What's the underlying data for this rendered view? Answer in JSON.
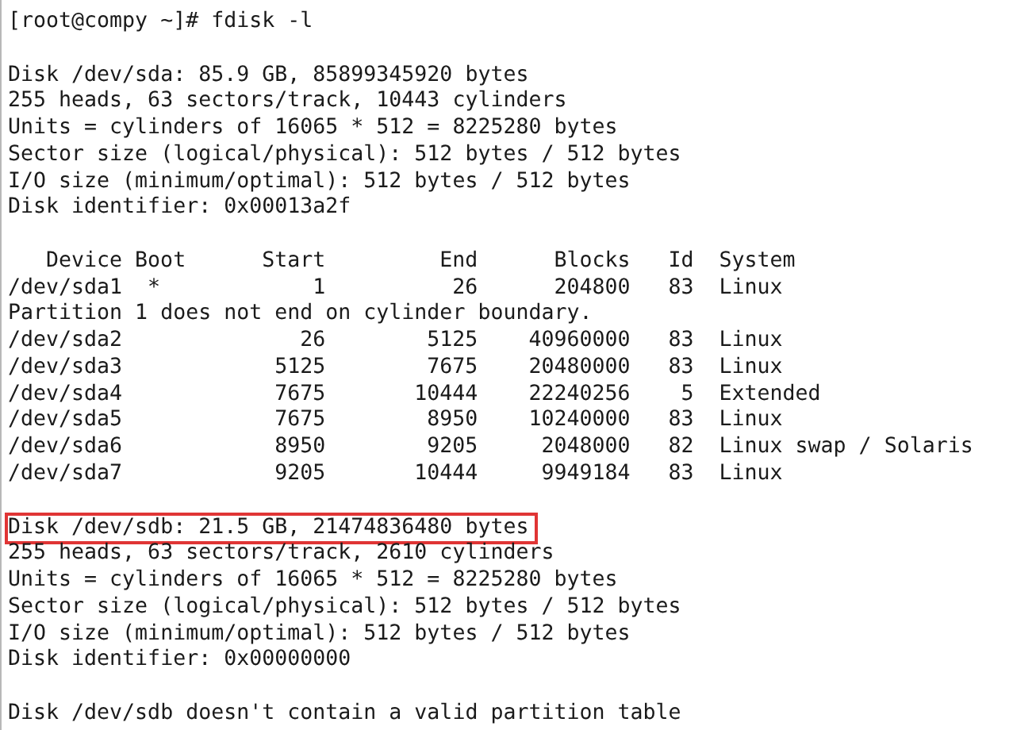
{
  "terminal": {
    "lines": [
      {
        "kind": "text",
        "text": "[root@compy ~]# fdisk -l",
        "highlighted": false
      },
      {
        "kind": "blank"
      },
      {
        "kind": "text",
        "text": "Disk /dev/sda: 85.9 GB, 85899345920 bytes",
        "highlighted": false
      },
      {
        "kind": "text",
        "text": "255 heads, 63 sectors/track, 10443 cylinders",
        "highlighted": false
      },
      {
        "kind": "text",
        "text": "Units = cylinders of 16065 * 512 = 8225280 bytes",
        "highlighted": false
      },
      {
        "kind": "text",
        "text": "Sector size (logical/physical): 512 bytes / 512 bytes",
        "highlighted": false
      },
      {
        "kind": "text",
        "text": "I/O size (minimum/optimal): 512 bytes / 512 bytes",
        "highlighted": false
      },
      {
        "kind": "text",
        "text": "Disk identifier: 0x00013a2f",
        "highlighted": false
      },
      {
        "kind": "blank"
      },
      {
        "kind": "table",
        "columns": [
          "Device",
          "Boot",
          "Start",
          "End",
          "Blocks",
          "Id",
          "System"
        ],
        "rows": [
          {
            "kind": "partition",
            "device": "/dev/sda1",
            "boot": "*",
            "start": "1",
            "end": "26",
            "blocks": "204800",
            "id": "83",
            "system": "Linux"
          },
          {
            "kind": "note",
            "text": "Partition 1 does not end on cylinder boundary."
          },
          {
            "kind": "partition",
            "device": "/dev/sda2",
            "start": "26",
            "end": "5125",
            "blocks": "40960000",
            "id": "83",
            "system": "Linux"
          },
          {
            "kind": "partition",
            "device": "/dev/sda3",
            "start": "5125",
            "end": "7675",
            "blocks": "20480000",
            "id": "83",
            "system": "Linux"
          },
          {
            "kind": "partition",
            "device": "/dev/sda4",
            "start": "7675",
            "end": "10444",
            "blocks": "22240256",
            "id": "5",
            "system": "Extended"
          },
          {
            "kind": "partition",
            "device": "/dev/sda5",
            "start": "7675",
            "end": "8950",
            "blocks": "10240000",
            "id": "83",
            "system": "Linux"
          },
          {
            "kind": "partition",
            "device": "/dev/sda6",
            "start": "8950",
            "end": "9205",
            "blocks": "2048000",
            "id": "82",
            "system": "Linux swap / Solaris"
          },
          {
            "kind": "partition",
            "device": "/dev/sda7",
            "start": "9205",
            "end": "10444",
            "blocks": "9949184",
            "id": "83",
            "system": "Linux"
          }
        ]
      },
      {
        "kind": "blank"
      },
      {
        "kind": "text",
        "text": "Disk /dev/sdb: 21.5 GB, 21474836480 bytes",
        "highlighted": true
      },
      {
        "kind": "text",
        "text": "255 heads, 63 sectors/track, 2610 cylinders",
        "highlighted": false
      },
      {
        "kind": "text",
        "text": "Units = cylinders of 16065 * 512 = 8225280 bytes",
        "highlighted": false
      },
      {
        "kind": "text",
        "text": "Sector size (logical/physical): 512 bytes / 512 bytes",
        "highlighted": false
      },
      {
        "kind": "text",
        "text": "I/O size (minimum/optimal): 512 bytes / 512 bytes",
        "highlighted": false
      },
      {
        "kind": "text",
        "text": "Disk identifier: 0x00000000",
        "highlighted": false
      },
      {
        "kind": "blank"
      },
      {
        "kind": "text",
        "text": "Disk /dev/sdb doesn't contain a valid partition table",
        "highlighted": false
      }
    ]
  }
}
